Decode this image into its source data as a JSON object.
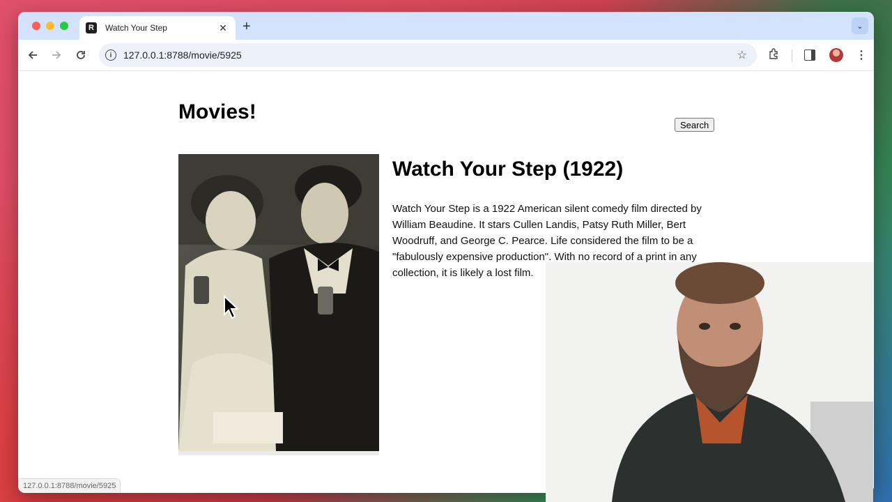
{
  "browser": {
    "tab": {
      "title": "Watch Your Step",
      "favicon_letter": "R"
    },
    "address_bar": {
      "url": "127.0.0.1:8788/movie/5925"
    },
    "status_url": "127.0.0.1:8788/movie/5925"
  },
  "page": {
    "site_title": "Movies!",
    "search_label": "Search",
    "movie": {
      "title": "Watch Your Step (1922)",
      "description": "Watch Your Step is a 1922 American silent comedy film directed by William Beaudine. It stars Cullen Landis, Patsy Ruth Miller, Bert Woodruff, and George C. Pearce. Life considered the film to be a \"fabulously expensive production\". With no record of a print in any collection, it is likely a lost film."
    }
  },
  "icons": {
    "back": "arrow-left-icon",
    "forward": "arrow-right-icon",
    "reload": "reload-icon",
    "info": "info-icon",
    "bookmark": "star-icon",
    "extensions": "puzzle-icon",
    "side_panel": "side-panel-icon",
    "profile": "avatar-icon",
    "menu": "kebab-icon"
  },
  "colors": {
    "tabstrip": "#d3e3fd",
    "omnibox": "#edf2fa",
    "page_background": "#ffffff"
  }
}
